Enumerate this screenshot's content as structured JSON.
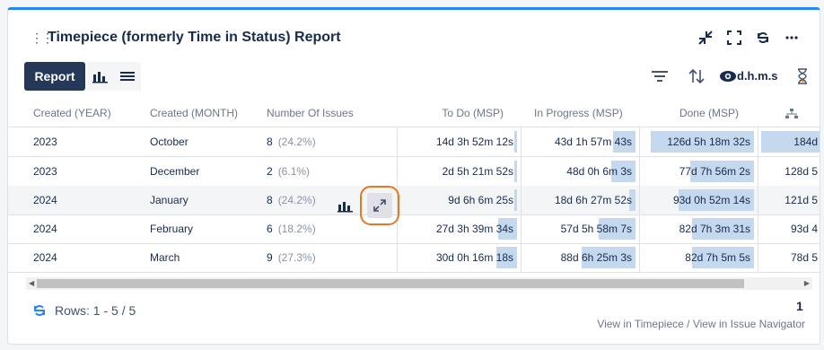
{
  "gadget": {
    "title": "Timepiece (formerly Time in Status) Report",
    "header_icons": [
      "collapse-icon",
      "fullscreen-icon",
      "refresh-icon",
      "more-icon"
    ]
  },
  "toolbar": {
    "report_label": "Report",
    "view_icons": [
      "bar-chart-icon",
      "list-icon"
    ],
    "right_icons": [
      "filter-icon",
      "sort-icon",
      "eye-icon",
      "hourglass-icon"
    ],
    "time_format": "d.h.m.s"
  },
  "table": {
    "headers": {
      "year": "Created (YEAR)",
      "month": "Created (MONTH)",
      "issues": "Number Of Issues",
      "todo": "To Do (MSP)",
      "inprogress": "In Progress (MSP)",
      "done": "Done (MSP)"
    },
    "rows": [
      {
        "year": "2023",
        "month": "October",
        "issues": "8",
        "pct": "(24.2%)",
        "todo": "14d 3h 52m 12s",
        "todo_fill": 0.02,
        "inprogress": "43d 1h 57m 43s",
        "inprogress_fill": 0.2,
        "done": "126d 5h 18m 32s",
        "done_fill": 0.93,
        "next": "184d"
      },
      {
        "year": "2023",
        "month": "December",
        "issues": "2",
        "pct": "(6.1%)",
        "todo": "2d 5h 21m 52s",
        "todo_fill": 0.02,
        "inprogress": "48d 0h 6m 3s",
        "inprogress_fill": 0.22,
        "done": "77d 7h 56m 2s",
        "done_fill": 0.57,
        "next": "128d 5"
      },
      {
        "year": "2024",
        "month": "January",
        "issues": "8",
        "pct": "(24.2%)",
        "todo": "9d 6h 6m 25s",
        "todo_fill": 0.02,
        "inprogress": "18d 6h 27m 52s",
        "inprogress_fill": 0.06,
        "done": "93d 0h 52m 14s",
        "done_fill": 0.68,
        "next": "121d 5"
      },
      {
        "year": "2024",
        "month": "February",
        "issues": "6",
        "pct": "(18.2%)",
        "todo": "27d 3h 39m 34s",
        "todo_fill": 0.16,
        "inprogress": "57d 5h 58m 7s",
        "inprogress_fill": 0.33,
        "done": "82d 7h 3m 31s",
        "done_fill": 0.56,
        "next": "93d 4"
      },
      {
        "year": "2024",
        "month": "March",
        "issues": "9",
        "pct": "(27.3%)",
        "todo": "30d 0h 16m 18s",
        "todo_fill": 0.18,
        "inprogress": "88d 6h 25m 3s",
        "inprogress_fill": 0.48,
        "done": "82d 7h 5m 5s",
        "done_fill": 0.56,
        "next": "78d 5"
      }
    ]
  },
  "footer": {
    "rows_label": "Rows: 1 - 5 / 5",
    "page": "1",
    "link_timepiece": "View in Timepiece",
    "separator": " / ",
    "link_navigator": "View in Issue Navigator"
  },
  "colors": {
    "accent": "#2684ff",
    "report_button": "#253858",
    "bar_fill": "#c4d9ee",
    "highlight_ring": "#e87722"
  }
}
